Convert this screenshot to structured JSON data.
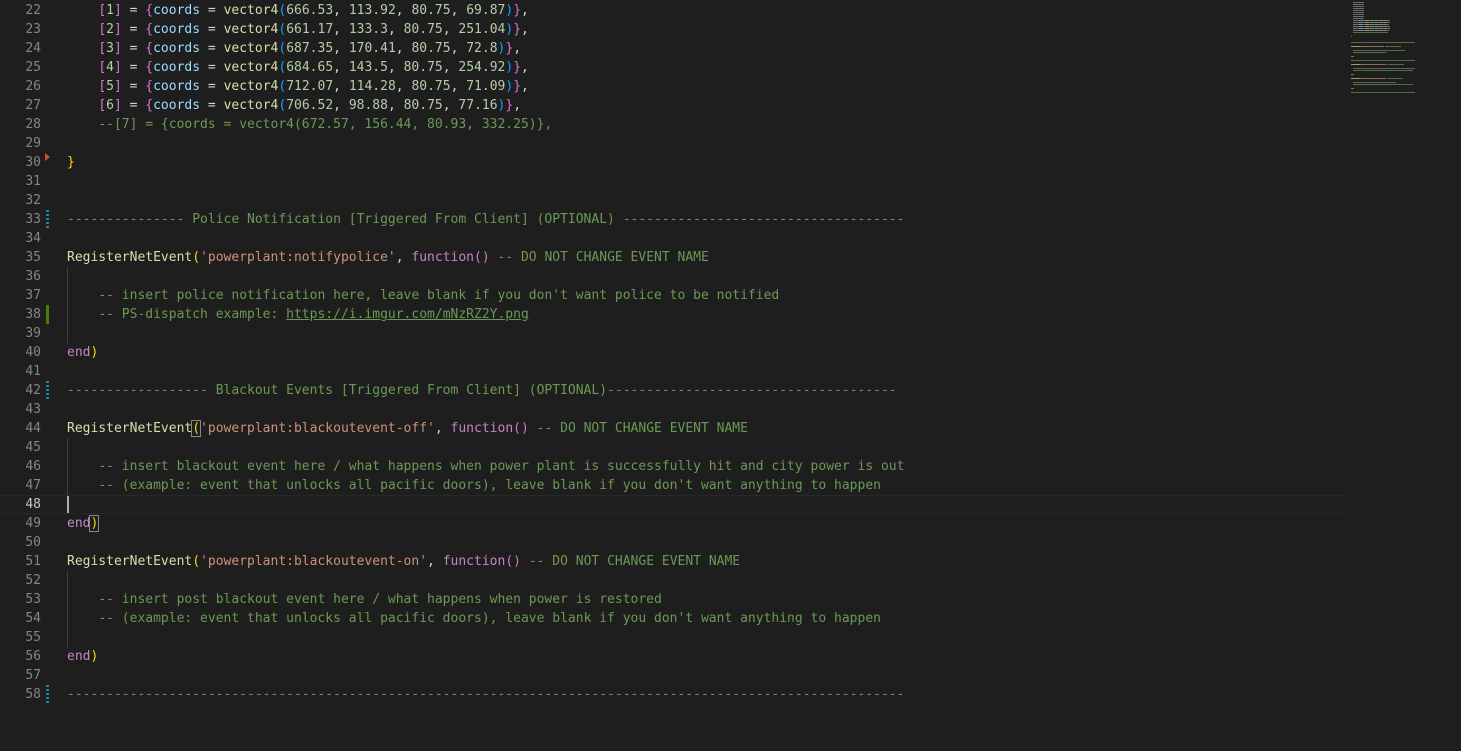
{
  "editor": {
    "lines": [
      {
        "n": "22",
        "indent": "    ",
        "tokens": [
          [
            "br2",
            "["
          ],
          [
            "num",
            "1"
          ],
          [
            "br2",
            "]"
          ],
          [
            "p",
            " = "
          ],
          [
            "br2",
            "{"
          ],
          [
            "var",
            "coords"
          ],
          [
            "p",
            " = "
          ],
          [
            "fn",
            "vector4"
          ],
          [
            "br3",
            "("
          ],
          [
            "num",
            "666.53"
          ],
          [
            "p",
            ", "
          ],
          [
            "num",
            "113.92"
          ],
          [
            "p",
            ", "
          ],
          [
            "num",
            "80.75"
          ],
          [
            "p",
            ", "
          ],
          [
            "num",
            "69.87"
          ],
          [
            "br3",
            ")"
          ],
          [
            "br2",
            "}"
          ],
          [
            "p",
            ","
          ]
        ]
      },
      {
        "n": "23",
        "indent": "    ",
        "tokens": [
          [
            "br2",
            "["
          ],
          [
            "num",
            "2"
          ],
          [
            "br2",
            "]"
          ],
          [
            "p",
            " = "
          ],
          [
            "br2",
            "{"
          ],
          [
            "var",
            "coords"
          ],
          [
            "p",
            " = "
          ],
          [
            "fn",
            "vector4"
          ],
          [
            "br3",
            "("
          ],
          [
            "num",
            "661.17"
          ],
          [
            "p",
            ", "
          ],
          [
            "num",
            "133.3"
          ],
          [
            "p",
            ", "
          ],
          [
            "num",
            "80.75"
          ],
          [
            "p",
            ", "
          ],
          [
            "num",
            "251.04"
          ],
          [
            "br3",
            ")"
          ],
          [
            "br2",
            "}"
          ],
          [
            "p",
            ","
          ]
        ]
      },
      {
        "n": "24",
        "indent": "    ",
        "tokens": [
          [
            "br2",
            "["
          ],
          [
            "num",
            "3"
          ],
          [
            "br2",
            "]"
          ],
          [
            "p",
            " = "
          ],
          [
            "br2",
            "{"
          ],
          [
            "var",
            "coords"
          ],
          [
            "p",
            " = "
          ],
          [
            "fn",
            "vector4"
          ],
          [
            "br3",
            "("
          ],
          [
            "num",
            "687.35"
          ],
          [
            "p",
            ", "
          ],
          [
            "num",
            "170.41"
          ],
          [
            "p",
            ", "
          ],
          [
            "num",
            "80.75"
          ],
          [
            "p",
            ", "
          ],
          [
            "num",
            "72.8"
          ],
          [
            "br3",
            ")"
          ],
          [
            "br2",
            "}"
          ],
          [
            "p",
            ","
          ]
        ]
      },
      {
        "n": "25",
        "indent": "    ",
        "tokens": [
          [
            "br2",
            "["
          ],
          [
            "num",
            "4"
          ],
          [
            "br2",
            "]"
          ],
          [
            "p",
            " = "
          ],
          [
            "br2",
            "{"
          ],
          [
            "var",
            "coords"
          ],
          [
            "p",
            " = "
          ],
          [
            "fn",
            "vector4"
          ],
          [
            "br3",
            "("
          ],
          [
            "num",
            "684.65"
          ],
          [
            "p",
            ", "
          ],
          [
            "num",
            "143.5"
          ],
          [
            "p",
            ", "
          ],
          [
            "num",
            "80.75"
          ],
          [
            "p",
            ", "
          ],
          [
            "num",
            "254.92"
          ],
          [
            "br3",
            ")"
          ],
          [
            "br2",
            "}"
          ],
          [
            "p",
            ","
          ]
        ]
      },
      {
        "n": "26",
        "indent": "    ",
        "tokens": [
          [
            "br2",
            "["
          ],
          [
            "num",
            "5"
          ],
          [
            "br2",
            "]"
          ],
          [
            "p",
            " = "
          ],
          [
            "br2",
            "{"
          ],
          [
            "var",
            "coords"
          ],
          [
            "p",
            " = "
          ],
          [
            "fn",
            "vector4"
          ],
          [
            "br3",
            "("
          ],
          [
            "num",
            "712.07"
          ],
          [
            "p",
            ", "
          ],
          [
            "num",
            "114.28"
          ],
          [
            "p",
            ", "
          ],
          [
            "num",
            "80.75"
          ],
          [
            "p",
            ", "
          ],
          [
            "num",
            "71.09"
          ],
          [
            "br3",
            ")"
          ],
          [
            "br2",
            "}"
          ],
          [
            "p",
            ","
          ]
        ]
      },
      {
        "n": "27",
        "indent": "    ",
        "tokens": [
          [
            "br2",
            "["
          ],
          [
            "num",
            "6"
          ],
          [
            "br2",
            "]"
          ],
          [
            "p",
            " = "
          ],
          [
            "br2",
            "{"
          ],
          [
            "var",
            "coords"
          ],
          [
            "p",
            " = "
          ],
          [
            "fn",
            "vector4"
          ],
          [
            "br3",
            "("
          ],
          [
            "num",
            "706.52"
          ],
          [
            "p",
            ", "
          ],
          [
            "num",
            "98.88"
          ],
          [
            "p",
            ", "
          ],
          [
            "num",
            "80.75"
          ],
          [
            "p",
            ", "
          ],
          [
            "num",
            "77.16"
          ],
          [
            "br3",
            ")"
          ],
          [
            "br2",
            "}"
          ],
          [
            "p",
            ","
          ]
        ]
      },
      {
        "n": "28",
        "indent": "    ",
        "tokens": [
          [
            "c",
            "--[7] = {coords = vector4(672.57, 156.44, 80.93, 332.25)},"
          ]
        ]
      },
      {
        "n": "29",
        "tokens": []
      },
      {
        "n": "30",
        "gutter": "del",
        "tokens": [
          [
            "br1",
            "}"
          ]
        ]
      },
      {
        "n": "31",
        "tokens": []
      },
      {
        "n": "32",
        "tokens": []
      },
      {
        "n": "33",
        "gutter": "mod",
        "tokens": [
          [
            "c",
            "--------------- Police Notification [Triggered From Client] (OPTIONAL) ------------------------------------"
          ]
        ]
      },
      {
        "n": "34",
        "tokens": []
      },
      {
        "n": "35",
        "tokens": [
          [
            "fn",
            "RegisterNetEvent"
          ],
          [
            "br1",
            "("
          ],
          [
            "str",
            "'powerplant:notifypolice'"
          ],
          [
            "p",
            ", "
          ],
          [
            "kw",
            "function"
          ],
          [
            "br2",
            "()"
          ],
          [
            "p",
            " "
          ],
          [
            "c",
            "-- DO NOT CHANGE EVENT NAME"
          ]
        ]
      },
      {
        "n": "36",
        "guide": true,
        "tokens": []
      },
      {
        "n": "37",
        "guide": true,
        "indent": "    ",
        "tokens": [
          [
            "c",
            "-- insert police notification here, leave blank if you don't want police to be notified"
          ]
        ]
      },
      {
        "n": "38",
        "guide": true,
        "gutter": "add",
        "indent": "    ",
        "tokens": [
          [
            "c",
            "-- PS-dispatch example: "
          ],
          [
            "url",
            "https://i.imgur.com/mNzRZ2Y.png"
          ]
        ]
      },
      {
        "n": "39",
        "guide": true,
        "tokens": []
      },
      {
        "n": "40",
        "tokens": [
          [
            "kw",
            "end"
          ],
          [
            "br1",
            ")"
          ]
        ]
      },
      {
        "n": "41",
        "tokens": []
      },
      {
        "n": "42",
        "gutter": "mod",
        "tokens": [
          [
            "c",
            "------------------ Blackout Events [Triggered From Client] (OPTIONAL)-------------------------------------"
          ]
        ]
      },
      {
        "n": "43",
        "tokens": []
      },
      {
        "n": "44",
        "tokens": [
          [
            "fn",
            "RegisterNetEvent"
          ],
          [
            "br1bm",
            "("
          ],
          [
            "str",
            "'powerplant:blackoutevent-off'"
          ],
          [
            "p",
            ", "
          ],
          [
            "kw",
            "function"
          ],
          [
            "br2",
            "()"
          ],
          [
            "p",
            " "
          ],
          [
            "c",
            "-- DO NOT CHANGE EVENT NAME"
          ]
        ]
      },
      {
        "n": "45",
        "guide": true,
        "tokens": []
      },
      {
        "n": "46",
        "guide": true,
        "indent": "    ",
        "tokens": [
          [
            "c",
            "-- insert blackout event here / what happens when power plant is successfully hit and city power is out"
          ]
        ]
      },
      {
        "n": "47",
        "guide": true,
        "indent": "    ",
        "tokens": [
          [
            "c",
            "-- (example: event that unlocks all pacific doors), leave blank if you don't want anything to happen"
          ]
        ]
      },
      {
        "n": "48",
        "current": true,
        "tokens": []
      },
      {
        "n": "49",
        "tokens": [
          [
            "kw",
            "end"
          ],
          [
            "br1bm",
            ")"
          ]
        ]
      },
      {
        "n": "50",
        "tokens": []
      },
      {
        "n": "51",
        "tokens": [
          [
            "fn",
            "RegisterNetEvent"
          ],
          [
            "br1",
            "("
          ],
          [
            "str",
            "'powerplant:blackoutevent-on'"
          ],
          [
            "p",
            ", "
          ],
          [
            "kw",
            "function"
          ],
          [
            "br2",
            "()"
          ],
          [
            "p",
            " "
          ],
          [
            "c",
            "-- DO NOT CHANGE EVENT NAME"
          ]
        ]
      },
      {
        "n": "52",
        "guide": true,
        "tokens": []
      },
      {
        "n": "53",
        "guide": true,
        "indent": "    ",
        "tokens": [
          [
            "c",
            "-- insert post blackout event here / what happens when power is restored"
          ]
        ]
      },
      {
        "n": "54",
        "guide": true,
        "indent": "    ",
        "tokens": [
          [
            "c",
            "-- (example: event that unlocks all pacific doors), leave blank if you don't want anything to happen"
          ]
        ]
      },
      {
        "n": "55",
        "guide": true,
        "tokens": []
      },
      {
        "n": "56",
        "tokens": [
          [
            "kw",
            "end"
          ],
          [
            "br1",
            ")"
          ]
        ]
      },
      {
        "n": "57",
        "tokens": []
      },
      {
        "n": "58",
        "gutter": "mod",
        "tokens": [
          [
            "c",
            "-----------------------------------------------------------------------------------------------------------"
          ]
        ]
      }
    ]
  },
  "colors": {
    "background": "#1e1e1e",
    "comment": "#6a9955",
    "function": "#dcdcaa",
    "string": "#ce9178",
    "keyword": "#c586c0",
    "variable": "#9cdcfe",
    "number": "#b5cea8"
  }
}
